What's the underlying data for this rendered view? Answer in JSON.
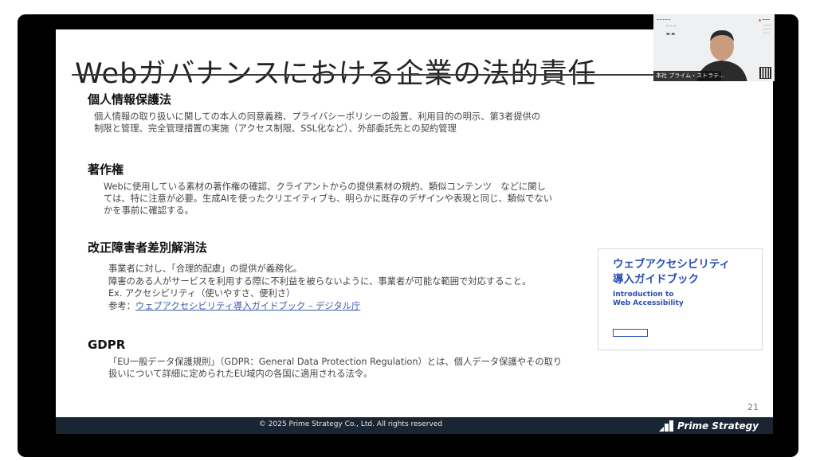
{
  "slide": {
    "title": "Webガバナンスにおける企業の法的責任",
    "page_number": "21"
  },
  "sections": [
    {
      "heading": "個人情報保護法",
      "lines": [
        "個人情報の取り扱いに関しての本人の同意義務、プライバシーポリシーの設置、利用目的の明示、第3者提供の",
        "制限と管理、完全管理措置の実施（アクセス制限、SSL化など）、外部委託先との契約管理"
      ]
    },
    {
      "heading": "著作権",
      "lines": [
        "Webに使用している素材の著作権の確認、クライアントからの提供素材の規約、類似コンテンツ　などに関し",
        "ては、特に注意が必要。生成AIを使ったクリエイティブも、明らかに既存のデザインや表現と同じ、類似でない",
        "かを事前に確認する。"
      ]
    },
    {
      "heading": "改正障害者差別解消法",
      "lines": [
        "事業者に対し、「合理的配慮」の提供が義務化。",
        "障害のある人がサービスを利用する際に不利益を被らないように、事業者が可能な範囲で対応すること。",
        "Ex. アクセシビリティ（使いやすさ、便利さ）"
      ],
      "reference_prefix": "参考：",
      "reference_link": "ウェブアクセシビリティ導入ガイドブック – デジタル庁"
    },
    {
      "heading": "GDPR",
      "lines": [
        "「EU一般データ保護規則」（GDPR：General Data Protection Regulation）とは、個人データ保護やその取り",
        "扱いについて詳細に定められたEU域内の各国に適用される法令。"
      ]
    }
  ],
  "guidebook": {
    "title_line1": "ウェブアクセシビリティ",
    "title_line2": "導入ガイドブック",
    "subtitle_line1": "Introduction to",
    "subtitle_line2": "Web Accessibility"
  },
  "footer": {
    "copyright": "© 2025 Prime Strategy Co., Ltd. All rights reserved",
    "brand": "Prime Strategy"
  },
  "video": {
    "participant_label": "本社 プライム・ストラテ..."
  },
  "colors": {
    "footer_bg": "#1a2533",
    "guidebook_blue": "#2a4db5",
    "link_blue": "#3b5da8",
    "frame_bg": "#000000"
  }
}
